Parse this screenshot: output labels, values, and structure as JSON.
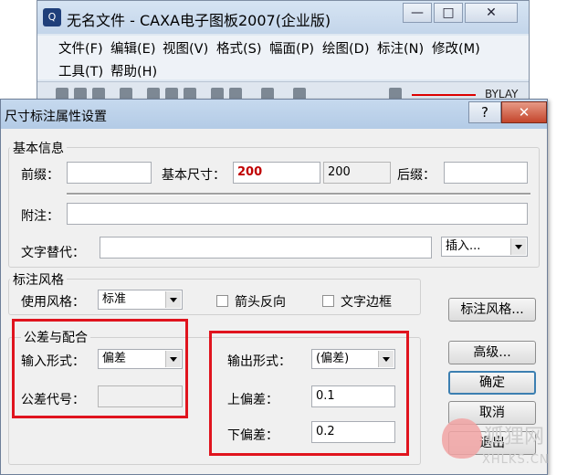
{
  "main_window": {
    "logo": "Q",
    "title": "无名文件 - CAXA电子图板2007(企业版)",
    "controls": {
      "minimize": "—",
      "maximize": "□",
      "close": "✕"
    },
    "menu": [
      "文件(F)",
      "编辑(E)",
      "视图(V)",
      "格式(S)",
      "幅面(P)",
      "绘图(D)",
      "标注(N)",
      "修改(M)",
      "工具(T)",
      "帮助(H)"
    ],
    "toolbar": {
      "layer_text": "BYLAY"
    }
  },
  "dialog": {
    "title": "尺寸标注属性设置",
    "help_label": "?",
    "close_label": "✕",
    "basic_info": {
      "title": "基本信息",
      "prefix_label": "前缀：",
      "prefix_value": "",
      "base_size_label": "基本尺寸：",
      "base_size_value": "200",
      "base_size_display": "200",
      "suffix_label": "后缀：",
      "suffix_value": "",
      "note_label": "附注：",
      "note_value": "",
      "text_replace_label": "文字替代：",
      "text_replace_value": "",
      "insert_label": "插入..."
    },
    "style": {
      "title": "标注风格",
      "use_style_label": "使用风格：",
      "use_style_value": "标准",
      "arrow_reverse_label": "箭头反向",
      "arrow_reverse_checked": false,
      "text_border_label": "文字边框",
      "text_border_checked": false
    },
    "tolerance": {
      "title": "公差与配合",
      "input_form_label": "输入形式：",
      "input_form_value": "偏差",
      "tolerance_code_label": "公差代号：",
      "tolerance_code_value": "",
      "output_form_label": "输出形式：",
      "output_form_value": "(偏差)",
      "upper_dev_label": "上偏差：",
      "upper_dev_value": "0.1",
      "lower_dev_label": "下偏差：",
      "lower_dev_value": "0.2"
    },
    "buttons": {
      "style_button": "标注风格...",
      "advanced": "高级...",
      "ok": "确定",
      "cancel": "取消",
      "exit": "退出"
    }
  },
  "watermark": {
    "text": "狐狸网",
    "sub": "XHLKS.CN"
  },
  "colors": {
    "highlight_red": "#e0141e",
    "base_size_text": "#c00000",
    "default_button_border": "#3c7fb1"
  }
}
